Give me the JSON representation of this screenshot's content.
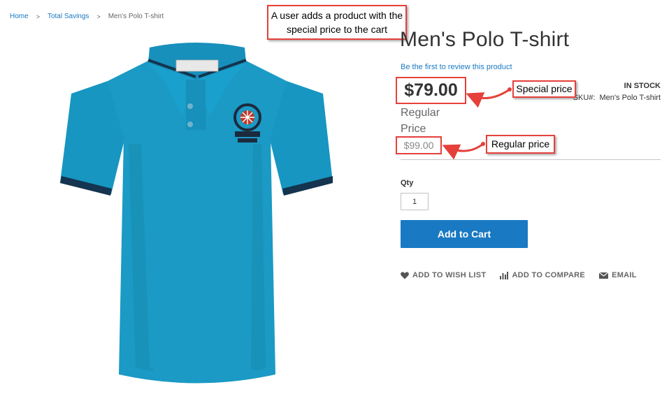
{
  "breadcrumb": {
    "items": [
      "Home",
      "Total Savings"
    ],
    "separator": ">",
    "current": "Men's Polo T-shirt"
  },
  "product": {
    "title": "Men's Polo T-shirt",
    "review_link": "Be the first to review this product",
    "stock": "IN STOCK",
    "sku_label": "SKU#:",
    "sku_value": "Men's Polo T-shirt",
    "special_price": "$79.00",
    "regular_label": "Regular Price",
    "old_price": "$99.00",
    "image_icon": "polo-shirt-image"
  },
  "form": {
    "qty_label": "Qty",
    "qty_value": "1",
    "add_to_cart": "Add to Cart"
  },
  "actions": [
    {
      "label": "ADD TO WISH LIST",
      "icon": "heart-icon"
    },
    {
      "label": "ADD TO COMPARE",
      "icon": "compare-icon"
    },
    {
      "label": "EMAIL",
      "icon": "envelope-icon"
    }
  ],
  "annotations": {
    "top": "A user adds a product with the special price to the cart",
    "special": "Special price",
    "regular": "Regular price",
    "color": "#e5403a"
  },
  "colors": {
    "link": "#1979c3",
    "button": "#1979c3",
    "shirt": "#1a9ac4"
  }
}
